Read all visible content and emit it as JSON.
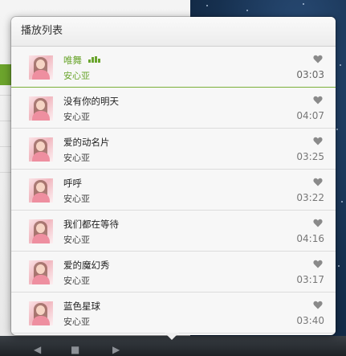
{
  "playlist": {
    "header_title": "播放列表",
    "songs": [
      {
        "title": "唯舞",
        "artist": "安心亚",
        "duration": "03:03",
        "playing": true
      },
      {
        "title": "没有你的明天",
        "artist": "安心亚",
        "duration": "04:07",
        "playing": false
      },
      {
        "title": "爱的动名片",
        "artist": "安心亚",
        "duration": "03:25",
        "playing": false
      },
      {
        "title": "呼呼",
        "artist": "安心亚",
        "duration": "03:22",
        "playing": false
      },
      {
        "title": "我们都在等待",
        "artist": "安心亚",
        "duration": "04:16",
        "playing": false
      },
      {
        "title": "爱的魔幻秀",
        "artist": "安心亚",
        "duration": "03:17",
        "playing": false
      },
      {
        "title": "蓝色星球",
        "artist": "安心亚",
        "duration": "03:40",
        "playing": false
      }
    ]
  },
  "colors": {
    "accent": "#6aa52d",
    "heart": "#8a8a8a"
  },
  "icons": {
    "playing_indicator": "equalizer-icon",
    "favorite": "heart-icon"
  }
}
